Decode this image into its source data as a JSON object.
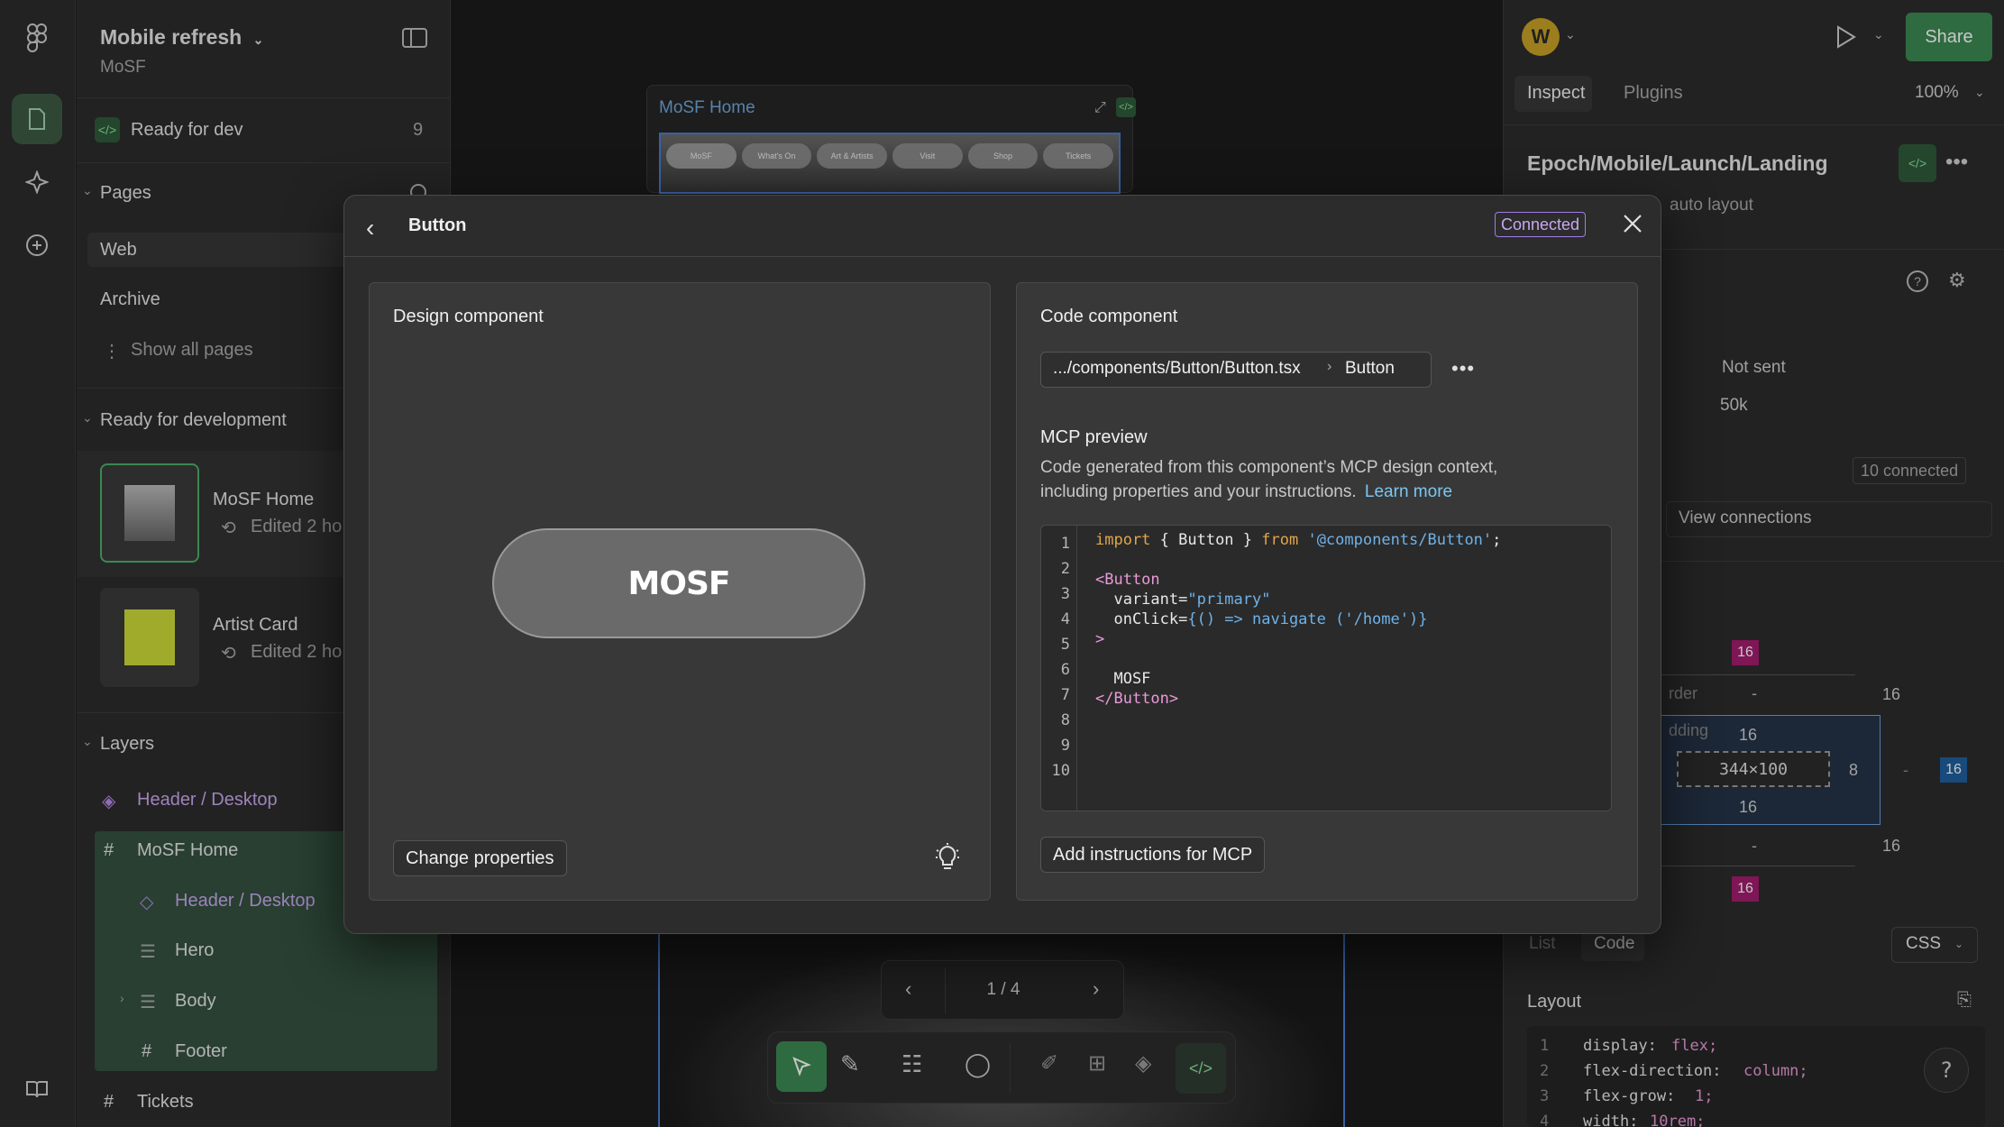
{
  "file": {
    "title": "Mobile refresh",
    "project": "MoSF"
  },
  "left": {
    "ready_label": "Ready for dev",
    "ready_count": "9",
    "pages_header": "Pages",
    "pages": [
      "Web",
      "Archive"
    ],
    "show_all": "Show all pages",
    "ready_section": "Ready for development",
    "ready_items": [
      {
        "name": "MoSF Home",
        "edited": "Edited 2 ho"
      },
      {
        "name": "Artist Card",
        "edited": "Edited 2 ho"
      }
    ],
    "layers_header": "Layers",
    "layers": [
      "Header / Desktop",
      "MoSF Home",
      "Header / Desktop",
      "Hero",
      "Body",
      "Footer",
      "Tickets"
    ]
  },
  "canvas": {
    "frame_title": "MoSF Home",
    "nav_items": [
      "MoSF",
      "What's On",
      "Art & Artists",
      "Visit",
      "Shop",
      "Tickets"
    ],
    "pager": "1 / 4"
  },
  "right": {
    "avatar": "W",
    "share": "Share",
    "tabs": [
      "Inspect",
      "Plugins"
    ],
    "zoom": "100%",
    "component_path": "Epoch/Mobile/Launch/Landing",
    "auto_layout": "auto layout",
    "status_value": "Not sent",
    "count_value": "50k",
    "connected_badge": "10 connected",
    "view_connections": "View connections",
    "box_model": {
      "top_margin": "16",
      "border_label": "rder",
      "border_top": "-",
      "border_bottom": "-",
      "padding_label": "dding",
      "padding_top": "16",
      "padding_bottom": "16",
      "padding_right": "8",
      "size": "344×100",
      "right_outer": "16",
      "right_dash": "-",
      "right_margin": "16",
      "radius_top": "16",
      "radius_bottom": "16",
      "bottom_margin": "16"
    },
    "view_tabs": [
      "List",
      "Code"
    ],
    "lang": "CSS",
    "layout_header": "Layout",
    "css_lines": [
      {
        "n": "1",
        "prop": "display:",
        "val": "flex;"
      },
      {
        "n": "2",
        "prop": "flex-direction:",
        "val": "column;"
      },
      {
        "n": "3",
        "prop": "flex-grow:",
        "val": "1;"
      },
      {
        "n": "4",
        "prop": "width:",
        "val": "10rem;"
      }
    ]
  },
  "modal": {
    "title": "Button",
    "badge": "Connected",
    "design_title": "Design component",
    "logo_text": "MOSF",
    "change_props": "Change properties",
    "code_title": "Code component",
    "path": ".../components/Button/Button.tsx",
    "component": "Button",
    "mcp_title": "MCP preview",
    "mcp_desc_1": "Code generated from this component’s MCP design context,",
    "mcp_desc_2": "including properties and your instructions.",
    "learn_more": "Learn more",
    "code_line_numbers": [
      "1",
      "2",
      "3",
      "4",
      "5",
      "6",
      "7",
      "8",
      "9",
      "10"
    ],
    "add_instructions": "Add instructions for MCP"
  }
}
